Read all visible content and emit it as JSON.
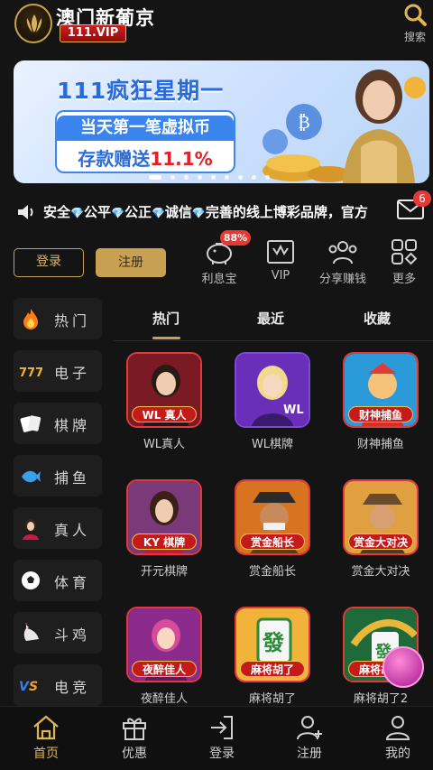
{
  "header": {
    "brand_title": "澳门新葡京",
    "brand_vip": "111.VIP",
    "search_label": "搜索"
  },
  "banner": {
    "headline": "111疯狂星期一",
    "line1": "当天第一笔虚拟币",
    "line2_prefix": "存款赠送",
    "line2_highlight": "11.1%",
    "slides_count": 9,
    "active_slide": 0
  },
  "marquee": {
    "text_parts": [
      "安全",
      "公平",
      "公正",
      "诚信",
      "完善的线上博彩品牌，官方"
    ]
  },
  "mail": {
    "badge": "6"
  },
  "auth": {
    "login": "登录",
    "register": "注册"
  },
  "quick_links": [
    {
      "label": "利息宝",
      "icon": "piggy-bank-icon",
      "badge": "88%"
    },
    {
      "label": "VIP",
      "icon": "vip-crown-icon"
    },
    {
      "label": "分享赚钱",
      "icon": "share-people-icon"
    },
    {
      "label": "更多",
      "icon": "more-grid-icon"
    }
  ],
  "categories": [
    {
      "label": "热门",
      "icon": "flame-icon"
    },
    {
      "label": "电子",
      "icon": "slot-777-icon"
    },
    {
      "label": "棋牌",
      "icon": "cards-icon"
    },
    {
      "label": "捕鱼",
      "icon": "fish-icon"
    },
    {
      "label": "真人",
      "icon": "live-dealer-icon"
    },
    {
      "label": "体育",
      "icon": "soccer-ball-icon"
    },
    {
      "label": "斗鸡",
      "icon": "rooster-icon"
    },
    {
      "label": "电竞",
      "icon": "vs-esports-icon"
    }
  ],
  "tabs": [
    {
      "label": "热门",
      "active": true
    },
    {
      "label": "最近",
      "active": false
    },
    {
      "label": "收藏",
      "active": false
    }
  ],
  "games": [
    {
      "name": "WL真人",
      "tag": "WL 真人",
      "theme": "#8a1f2a"
    },
    {
      "name": "WL棋牌",
      "tag": "",
      "theme": "#6a2fb8"
    },
    {
      "name": "财神捕鱼",
      "tag": "财神捕鱼",
      "theme": "#c43a1f"
    },
    {
      "name": "开元棋牌",
      "tag": "KY 棋牌",
      "theme": "#8a1f3a"
    },
    {
      "name": "赏金船长",
      "tag": "赏金船长",
      "theme": "#b8501f"
    },
    {
      "name": "赏金大对决",
      "tag": "赏金大对决",
      "theme": "#a8601f"
    },
    {
      "name": "夜醉佳人",
      "tag": "夜醉佳人",
      "theme": "#8a1f6a"
    },
    {
      "name": "麻将胡了",
      "tag": "麻将胡了",
      "theme": "#c88a1f"
    },
    {
      "name": "麻将胡了2",
      "tag": "麻将胡了",
      "theme": "#1f6a3a"
    }
  ],
  "bottom_nav": [
    {
      "label": "首页",
      "icon": "home-icon",
      "active": true
    },
    {
      "label": "优惠",
      "icon": "gift-icon",
      "active": false
    },
    {
      "label": "登录",
      "icon": "login-icon",
      "active": false
    },
    {
      "label": "注册",
      "icon": "add-user-icon",
      "active": false
    },
    {
      "label": "我的",
      "icon": "profile-icon",
      "active": false
    }
  ]
}
